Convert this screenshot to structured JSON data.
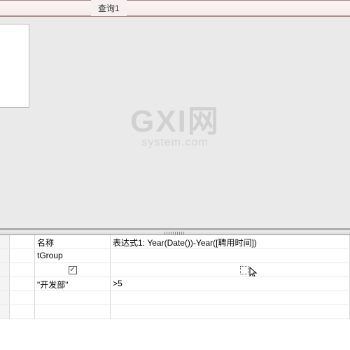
{
  "tab": {
    "title": "查询1"
  },
  "watermark": {
    "main": "GXI网",
    "sub": "system.com"
  },
  "grid": {
    "rows": [
      {
        "col2": "名称",
        "col3": "表达式1: Year(Date())-Year([聘用时间])"
      },
      {
        "col2": "tGroup",
        "col3": ""
      },
      {
        "col2": "",
        "col3": "",
        "cb2": "checked",
        "cb3": "dotted"
      },
      {
        "col2": "\"开发部\"",
        "col3": ">5"
      },
      {
        "col2": "",
        "col3": ""
      },
      {
        "col2": "",
        "col3": ""
      }
    ]
  }
}
